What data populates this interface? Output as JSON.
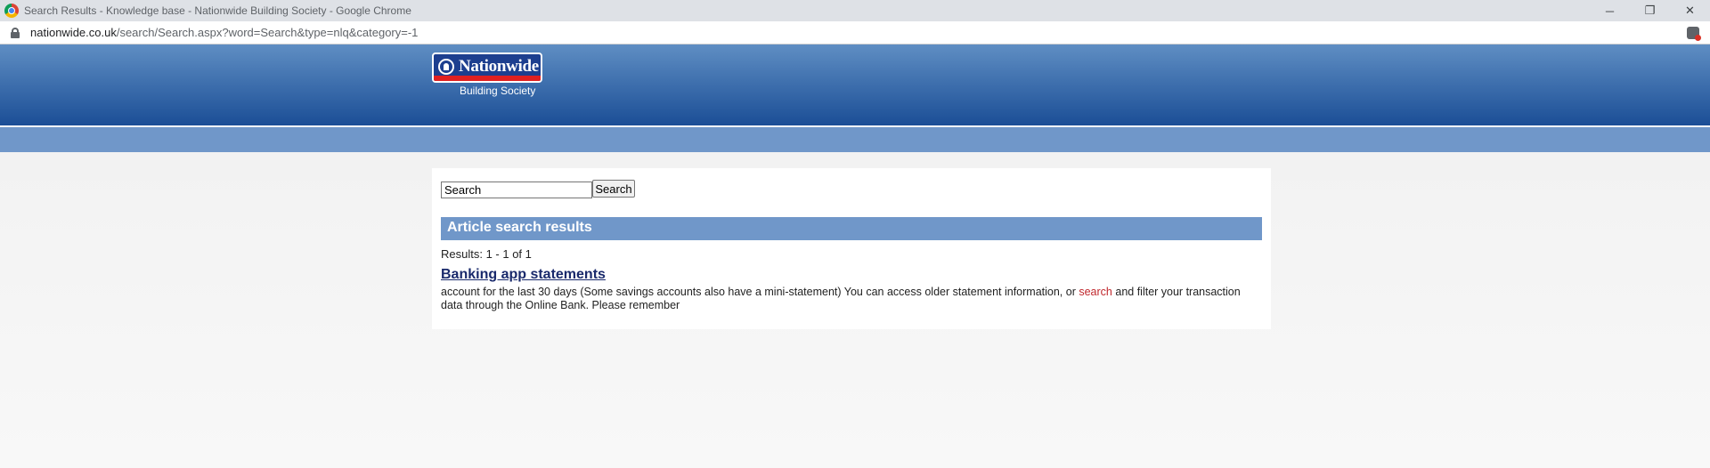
{
  "browser": {
    "window_title": "Search Results - Knowledge base - Nationwide Building Society - Google Chrome",
    "url_host": "nationwide.co.uk",
    "url_path": "/search/Search.aspx?word=Search&type=nlq&category=-1",
    "controls": {
      "minimize": "─",
      "restore": "❐",
      "close": "✕"
    }
  },
  "header": {
    "logo_text": "Nationwide",
    "logo_sub": "Building Society",
    "colors": {
      "band_top": "#5f8ec3",
      "band_bottom": "#1b4e96",
      "subnav": "#7097c9"
    }
  },
  "search": {
    "value": "Search",
    "button_label": "Search"
  },
  "results": {
    "header": "Article search results",
    "count": "Results: 1 - 1 of 1",
    "items": [
      {
        "title": "Banking app statements",
        "snippet_before": "account for the last 30 days (Some savings accounts also have a mini-statement) You can access older statement information, or ",
        "snippet_highlight": "search",
        "snippet_after": " and filter your transaction data through the Online Bank. Please remember"
      }
    ]
  }
}
